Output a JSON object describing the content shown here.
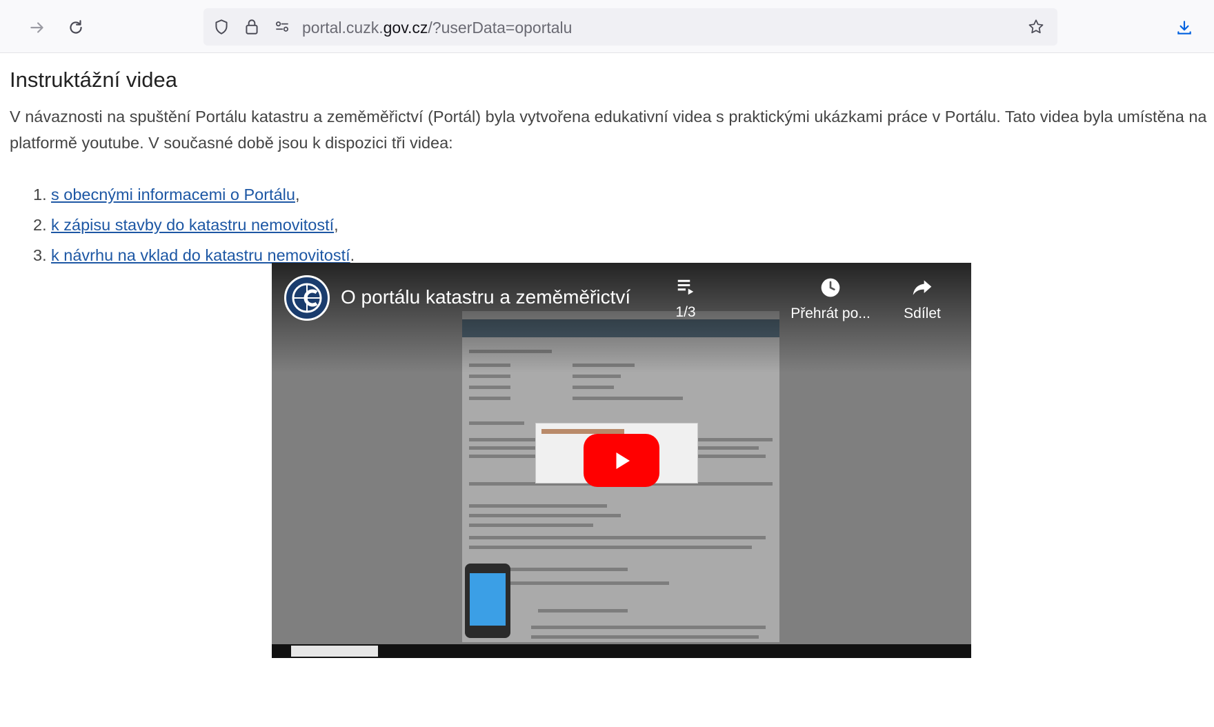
{
  "browser": {
    "url_prefix": "portal.cuzk.",
    "url_domain": "gov.cz",
    "url_path": "/?userData=oportalu",
    "icons": [
      "forward-icon",
      "reload-icon",
      "shield-icon",
      "lock-icon",
      "permissions-icon",
      "bookmark-star-icon",
      "downloads-icon"
    ]
  },
  "page": {
    "heading": "Instruktážní videa",
    "intro": "V návaznosti na spuštění Portálu katastru a zeměměřictví (Portál) byla vytvořena edukativní videa s praktickými ukázkami práce v Portálu. Tato videa byla umístěna na platformě youtube. V současné době jsou k dispozici tři videa:",
    "videos": [
      {
        "num": "1.",
        "link": "s obecnými informacemi o Portálu",
        "suffix": ","
      },
      {
        "num": "2.",
        "link": "k zápisu stavby do katastru nemovitostí",
        "suffix": ","
      },
      {
        "num": "3.",
        "link": "k návrhu na vklad do katastru nemovitostí",
        "suffix": "."
      }
    ]
  },
  "player": {
    "title": "O portálu katastru a zeměměřictví",
    "playlist_count": "1/3",
    "watch_later": "Přehrát po...",
    "share": "Sdílet",
    "accent": "#ff0000"
  }
}
